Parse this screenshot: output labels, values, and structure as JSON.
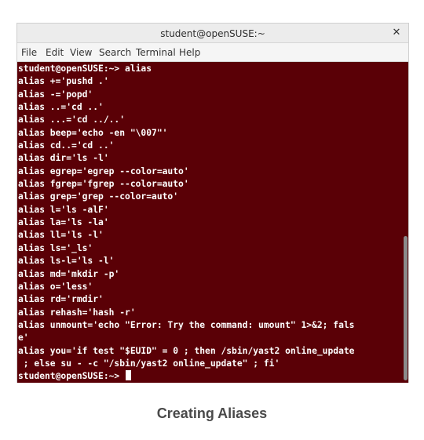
{
  "window": {
    "title": "student@openSUSE:~"
  },
  "menu": [
    "File",
    "Edit",
    "View",
    "Search",
    "Terminal",
    "Help"
  ],
  "terminal": {
    "lines": [
      "student@openSUSE:~> alias",
      "alias +='pushd .'",
      "alias -='popd'",
      "alias ..='cd ..'",
      "alias ...='cd ../..'",
      "alias beep='echo -en \"\\007\"'",
      "alias cd..='cd ..'",
      "alias dir='ls -l'",
      "alias egrep='egrep --color=auto'",
      "alias fgrep='fgrep --color=auto'",
      "alias grep='grep --color=auto'",
      "alias l='ls -alF'",
      "alias la='ls -la'",
      "alias ll='ls -l'",
      "alias ls='_ls'",
      "alias ls-l='ls -l'",
      "alias md='mkdir -p'",
      "alias o='less'",
      "alias rd='rmdir'",
      "alias rehash='hash -r'",
      "alias unmount='echo \"Error: Try the command: umount\" 1>&2; fals",
      "e'",
      "alias you='if test \"$EUID\" = 0 ; then /sbin/yast2 online_update",
      " ; else su - -c \"/sbin/yast2 online_update\" ; fi'"
    ],
    "prompt": "student@openSUSE:~> "
  },
  "caption": "Creating Aliases",
  "colors": {
    "terminal_bg": "#5a0006",
    "terminal_fg": "#ffffff"
  }
}
